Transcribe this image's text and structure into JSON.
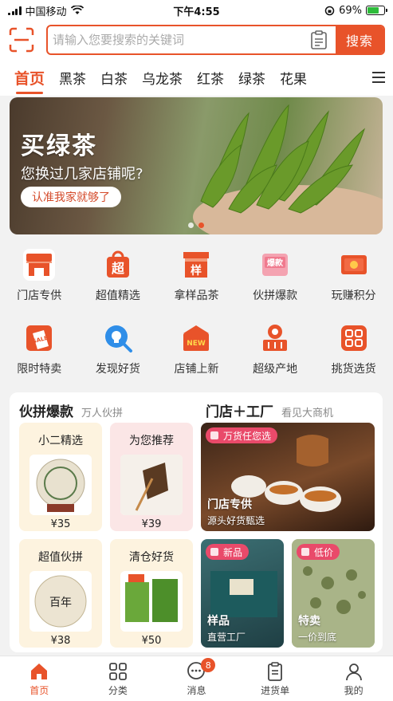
{
  "status_bar": {
    "carrier": "中国移动",
    "time": "下午4:55",
    "battery": "69%",
    "battery_level": 0.69
  },
  "search": {
    "placeholder": "请输入您要搜索的关键词",
    "button": "搜索"
  },
  "tabs": [
    "首页",
    "黑茶",
    "白茶",
    "乌龙茶",
    "红茶",
    "绿茶",
    "花果"
  ],
  "banner": {
    "title": "买绿茶",
    "subtitle": "您换过几家店铺呢?",
    "button": "认准我家就够了",
    "slide_index": 2,
    "slide_count": 2
  },
  "grid": [
    {
      "label": "门店专供",
      "icon": "storefront-icon",
      "color": "#e8532a"
    },
    {
      "label": "超值精选",
      "icon": "chao-bag-icon",
      "color": "#e8532a"
    },
    {
      "label": "拿样品茶",
      "icon": "sample-box-icon",
      "color": "#e8532a"
    },
    {
      "label": "伙拼爆款",
      "icon": "hot-deal-icon",
      "color": "#f07a8e"
    },
    {
      "label": "玩赚积分",
      "icon": "points-coupon-icon",
      "color": "#e8532a"
    },
    {
      "label": "限时特卖",
      "icon": "sale-tag-icon",
      "color": "#e8532a"
    },
    {
      "label": "发现好货",
      "icon": "idea-bulb-icon",
      "color": "#2f8ee8"
    },
    {
      "label": "店铺上新",
      "icon": "new-shop-icon",
      "color": "#e8532a"
    },
    {
      "label": "超级产地",
      "icon": "origin-basket-icon",
      "color": "#e8532a"
    },
    {
      "label": "挑货选货",
      "icon": "select-grid-icon",
      "color": "#e8532a"
    }
  ],
  "group_buy": {
    "title": "伙拼爆款",
    "subtitle": "万人伙拼",
    "cards": [
      {
        "title": "小二精选",
        "price": "¥35"
      },
      {
        "title": "为您推荐",
        "price": "¥39"
      },
      {
        "title": "超值伙拼",
        "price": "¥38"
      },
      {
        "title": "清仓好货",
        "price": "¥50"
      }
    ]
  },
  "store_factory": {
    "title": "门店＋工厂",
    "subtitle": "看见大商机",
    "feature": {
      "tag": "万货任您选",
      "name": "门店专供",
      "desc": "源头好货甄选"
    },
    "cards": [
      {
        "tag": "新品",
        "name": "样品",
        "desc": "直营工厂"
      },
      {
        "tag": "低价",
        "name": "特卖",
        "desc": "一价到底"
      }
    ]
  },
  "tabbar": [
    {
      "label": "首页",
      "icon": "home-icon",
      "active": true
    },
    {
      "label": "分类",
      "icon": "category-icon",
      "active": false
    },
    {
      "label": "消息",
      "icon": "message-icon",
      "active": false,
      "badge": "8"
    },
    {
      "label": "进货单",
      "icon": "order-list-icon",
      "active": false
    },
    {
      "label": "我的",
      "icon": "user-icon",
      "active": false
    }
  ]
}
